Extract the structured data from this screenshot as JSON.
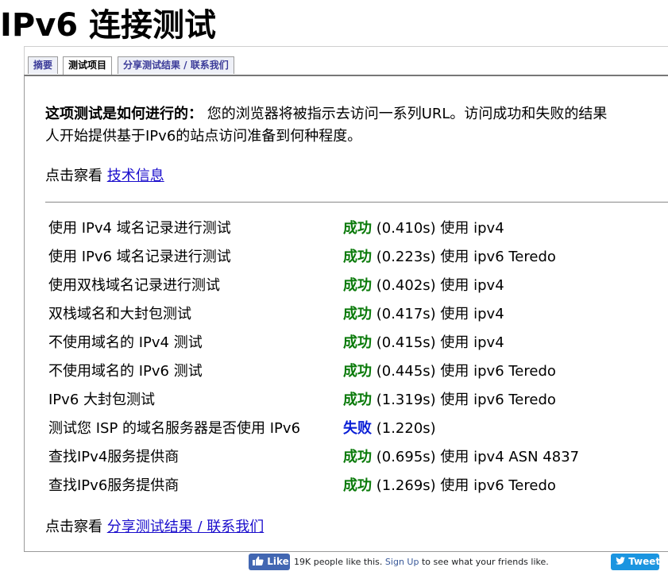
{
  "title": "IPv6 连接测试",
  "tabs": [
    {
      "label": "摘要",
      "active": false
    },
    {
      "label": "测试项目",
      "active": true
    },
    {
      "label": "分享测试结果 / 联系我们",
      "active": false
    }
  ],
  "description": {
    "bold": "这项测试是如何进行的：",
    "line1": " 您的浏览器将被指示去访问一系列URL。访问成功和失败的结果",
    "line2": "人开始提供基于IPv6的站点访问准备到何种程度。"
  },
  "tech_info": {
    "prefix": "点击察看 ",
    "link": "技术信息"
  },
  "results": [
    {
      "name": "使用 IPv4 域名记录进行测试",
      "status": "成功",
      "detail": " (0.410s) 使用 ipv4",
      "ok": true
    },
    {
      "name": "使用 IPv6 域名记录进行测试",
      "status": "成功",
      "detail": " (0.223s) 使用 ipv6 Teredo",
      "ok": true
    },
    {
      "name": "使用双栈域名记录进行测试",
      "status": "成功",
      "detail": " (0.402s) 使用 ipv4",
      "ok": true
    },
    {
      "name": "双栈域名和大封包测试",
      "status": "成功",
      "detail": " (0.417s) 使用 ipv4",
      "ok": true
    },
    {
      "name": "不使用域名的 IPv4 测试",
      "status": "成功",
      "detail": " (0.415s) 使用 ipv4",
      "ok": true
    },
    {
      "name": "不使用域名的 IPv6 测试",
      "status": "成功",
      "detail": " (0.445s) 使用 ipv6 Teredo",
      "ok": true
    },
    {
      "name": "IPv6 大封包测试",
      "status": "成功",
      "detail": " (1.319s) 使用 ipv6 Teredo",
      "ok": true
    },
    {
      "name": "测试您 ISP 的域名服务器是否使用 IPv6",
      "status": "失败",
      "detail": " (1.220s)",
      "ok": false
    },
    {
      "name": "查找IPv4服务提供商",
      "status": "成功",
      "detail": " (0.695s) 使用 ipv4 ASN 4837",
      "ok": true
    },
    {
      "name": "查找IPv6服务提供商",
      "status": "成功",
      "detail": " (1.269s) 使用 ipv6 Teredo",
      "ok": true
    }
  ],
  "share": {
    "prefix": "点击察看 ",
    "link": "分享测试结果 / 联系我们"
  },
  "social": {
    "like_label": "Like",
    "like_count_text": "19K people like this.",
    "signup_link": "Sign Up",
    "signup_suffix": " to see what your friends like.",
    "tweet_label": "Tweet",
    "like_icon": "thumbs-up-icon",
    "tweet_icon": "twitter-bird-icon"
  },
  "colors": {
    "success": "#0a7a0a",
    "failure": "#0a1fd6",
    "link": "#1a0dcc",
    "facebook": "#4267b2",
    "twitter": "#1b95e0"
  }
}
